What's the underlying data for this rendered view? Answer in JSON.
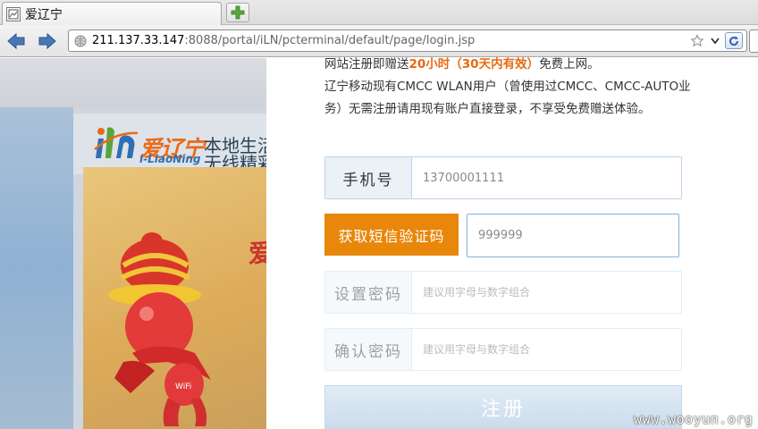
{
  "browser": {
    "tab_title": "爱辽宁",
    "url_host": "211.137.33.147",
    "url_rest": ":8088/portal/iLN/pcterminal/default/page/login.jsp"
  },
  "background": {
    "logo_cn": "爱辽宁",
    "logo_en": "i-LiaoNing",
    "slogan_line1": "本地生活",
    "slogan_line2": "无线精彩",
    "poster_text": "爱"
  },
  "panel": {
    "intro_before": "网站注册即赠送",
    "intro_highlight": "20小时（30天内有效）",
    "intro_after": "免费上网。",
    "intro_para2": "辽宁移动现有CMCC WLAN用户（曾使用过CMCC、CMCC-AUTO业务）无需注册请用现有账户直接登录，不享受免费赠送体验。",
    "phone_label": "手机号",
    "phone_value": "13700001111",
    "sms_button": "获取短信验证码",
    "sms_value": "999999",
    "pwd_label": "设置密码",
    "pwd_placeholder": "建议用字母与数字组合",
    "pwd2_label": "确认密码",
    "pwd2_placeholder": "建议用字母与数字组合",
    "register_button": "注册"
  },
  "watermark": "www.wooyun.org",
  "colors": {
    "accent_orange": "#e8870a",
    "highlight_orange": "#e8690f",
    "register_blue": "#cbdcec"
  }
}
